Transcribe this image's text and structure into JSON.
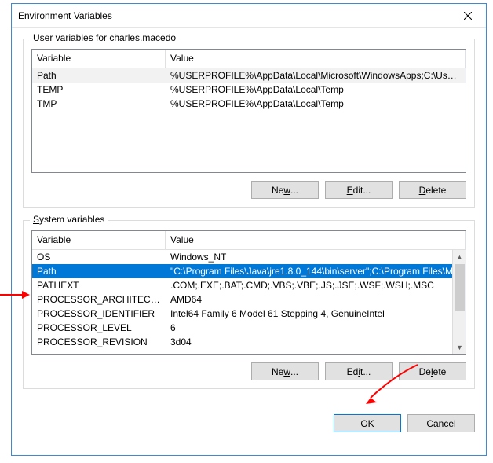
{
  "title": "Environment Variables",
  "user_group_label_prefix": "U",
  "user_group_label_rest": "ser variables for charles.macedo",
  "sys_group_label_prefix": "S",
  "sys_group_label_rest": "ystem variables",
  "col_variable": "Variable",
  "col_value": "Value",
  "user_vars": [
    {
      "name": "Path",
      "value": "%USERPROFILE%\\AppData\\Local\\Microsoft\\WindowsApps;C:\\User..."
    },
    {
      "name": "TEMP",
      "value": "%USERPROFILE%\\AppData\\Local\\Temp"
    },
    {
      "name": "TMP",
      "value": "%USERPROFILE%\\AppData\\Local\\Temp"
    }
  ],
  "sys_vars": [
    {
      "name": "OS",
      "value": "Windows_NT"
    },
    {
      "name": "Path",
      "value": "\"C:\\Program Files\\Java\\jre1.8.0_144\\bin\\server\";C:\\Program Files\\M..."
    },
    {
      "name": "PATHEXT",
      "value": ".COM;.EXE;.BAT;.CMD;.VBS;.VBE;.JS;.JSE;.WSF;.WSH;.MSC"
    },
    {
      "name": "PROCESSOR_ARCHITECTURE",
      "value": "AMD64"
    },
    {
      "name": "PROCESSOR_IDENTIFIER",
      "value": "Intel64 Family 6 Model 61 Stepping 4, GenuineIntel"
    },
    {
      "name": "PROCESSOR_LEVEL",
      "value": "6"
    },
    {
      "name": "PROCESSOR_REVISION",
      "value": "3d04"
    }
  ],
  "btn_new_prefix": "Ne",
  "btn_new_ul": "w",
  "btn_new_rest": "...",
  "btn_edit_ul": "E",
  "btn_edit_rest": "dit...",
  "btn_delete_ul": "D",
  "btn_delete_rest": "elete",
  "btn_edit2_prefix": "Ed",
  "btn_edit2_ul": "i",
  "btn_edit2_rest": "t...",
  "btn_delete2_prefix": "De",
  "btn_delete2_ul": "l",
  "btn_delete2_rest": "ete",
  "btn_ok": "OK",
  "btn_cancel": "Cancel"
}
